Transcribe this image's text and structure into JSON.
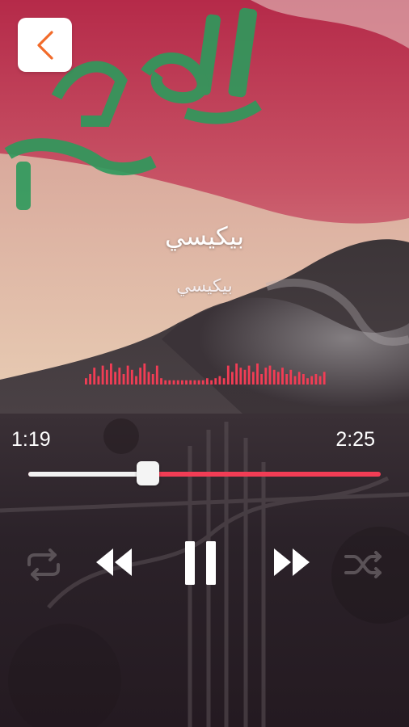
{
  "player": {
    "title": "بيكيسي",
    "artist": "بيكيسي",
    "elapsed": "1:19",
    "duration": "2:25",
    "progress": 0.34
  },
  "colors": {
    "accent": "#f23d55",
    "back_arrow": "#f26b2a",
    "text": "#ffffff"
  },
  "controls": {
    "back": "back-arrow-icon",
    "repeat": "repeat-icon",
    "rewind": "rewind-icon",
    "pause": "pause-icon",
    "forward": "fast-forward-icon",
    "shuffle": "shuffle-icon"
  },
  "visualizer_levels": [
    0.3,
    0.5,
    0.8,
    0.4,
    0.9,
    0.7,
    1.0,
    0.6,
    0.8,
    0.5,
    0.9,
    0.7,
    0.4,
    0.8,
    1.0,
    0.6,
    0.5,
    0.9,
    0.3,
    0.2,
    0.2,
    0.2,
    0.2,
    0.2,
    0.2,
    0.2,
    0.2,
    0.2,
    0.2,
    0.3,
    0.2,
    0.3,
    0.4,
    0.3,
    0.9,
    0.6,
    1.0,
    0.8,
    0.7,
    0.9,
    0.6,
    1.0,
    0.5,
    0.8,
    0.9,
    0.7,
    0.6,
    0.8,
    0.5,
    0.7,
    0.4,
    0.6,
    0.5,
    0.3,
    0.4,
    0.5,
    0.4,
    0.6
  ]
}
